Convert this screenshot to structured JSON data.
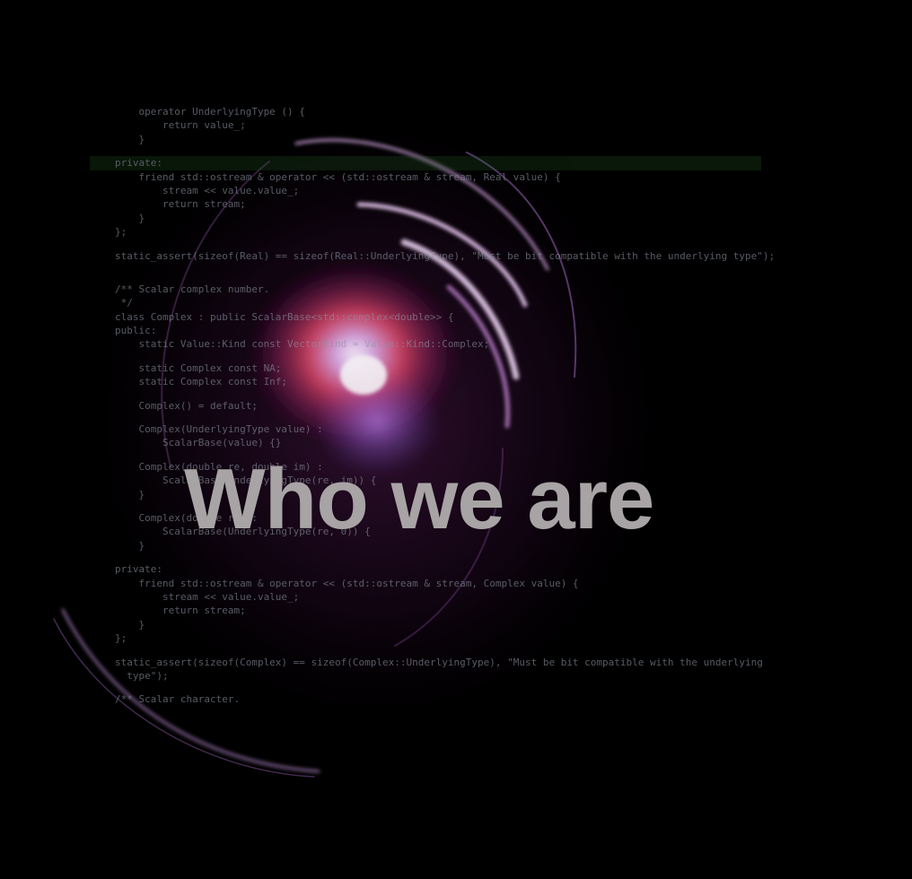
{
  "headline": "Who we are",
  "colors": {
    "background": "#000000",
    "glow_core": "#f04a6c",
    "glow_center": "#f0f0f0",
    "swirl": "#c87ad2",
    "headline": "#a8a3a5",
    "keyword": "#5a5aa8",
    "type": "#a8c85a",
    "string": "#b44cb4"
  },
  "code_lines": [
    "    operator UnderlyingType () {",
    "        return value_;",
    "    }",
    "",
    "private:",
    "    friend std::ostream & operator << (std::ostream & stream, Real value) {",
    "        stream << value.value_;",
    "        return stream;",
    "    }",
    "};",
    "",
    "static_assert(sizeof(Real) == sizeof(Real::UnderlyingType), \"Must be bit compatible with the underlying type\");",
    "",
    "",
    "/** Scalar complex number.",
    " */",
    "class Complex : public ScalarBase<std::complex<double>> {",
    "public:",
    "    static Value::Kind const VectorKind = Value::Kind::Complex;",
    "",
    "    static Complex const NA;",
    "    static Complex const Inf;",
    "",
    "    Complex() = default;",
    "",
    "    Complex(UnderlyingType value) :",
    "        ScalarBase(value) {}",
    "",
    "    Complex(double re, double im) :",
    "        ScalarBase(UnderlyingType(re, im)) {",
    "    }",
    "",
    "    Complex(double re) :",
    "        ScalarBase(UnderlyingType(re, 0)) {",
    "    }",
    "",
    "private:",
    "    friend std::ostream & operator << (std::ostream & stream, Complex value) {",
    "        stream << value.value_;",
    "        return stream;",
    "    }",
    "};",
    "",
    "static_assert(sizeof(Complex) == sizeof(Complex::UnderlyingType), \"Must be bit compatible with the underlying",
    "  type\");",
    "",
    "/** Scalar character."
  ]
}
